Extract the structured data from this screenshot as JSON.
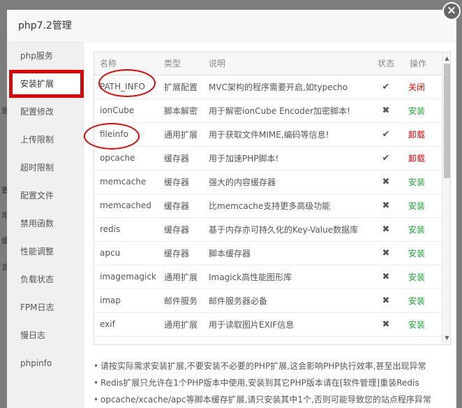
{
  "modal": {
    "title": "php7.2管理",
    "close_symbol": "×"
  },
  "sidebar": {
    "items": [
      {
        "label": "php服务",
        "active": false
      },
      {
        "label": "安装扩展",
        "active": true
      },
      {
        "label": "配置修改",
        "active": false
      },
      {
        "label": "上传限制",
        "active": false
      },
      {
        "label": "超时限制",
        "active": false
      },
      {
        "label": "配置文件",
        "active": false
      },
      {
        "label": "禁用函数",
        "active": false
      },
      {
        "label": "性能调整",
        "active": false
      },
      {
        "label": "负载状态",
        "active": false
      },
      {
        "label": "FPM日志",
        "active": false
      },
      {
        "label": "慢日志",
        "active": false
      },
      {
        "label": "phpinfo",
        "active": false
      }
    ]
  },
  "table": {
    "headers": {
      "name": "名称",
      "type": "类型",
      "desc": "说明",
      "status": "状态",
      "op": "操作"
    },
    "rows": [
      {
        "name": "PATH_INFO",
        "type": "扩展配置",
        "desc": "MVC架构的程序需要开启,如typecho",
        "status": "✔",
        "op": "关闭",
        "op_color": "red"
      },
      {
        "name": "ionCube",
        "type": "脚本解密",
        "desc": "用于解密ionCube Encoder加密脚本!",
        "status": "✖",
        "op": "安装",
        "op_color": "green"
      },
      {
        "name": "fileinfo",
        "type": "通用扩展",
        "desc": "用于获取文件MIME,编码等信息!",
        "status": "✔",
        "op": "卸载",
        "op_color": "red"
      },
      {
        "name": "opcache",
        "type": "缓存器",
        "desc": "用于加速PHP脚本!",
        "status": "✔",
        "op": "卸载",
        "op_color": "red"
      },
      {
        "name": "memcache",
        "type": "缓存器",
        "desc": "强大的内容缓存器",
        "status": "✖",
        "op": "安装",
        "op_color": "green"
      },
      {
        "name": "memcached",
        "type": "缓存器",
        "desc": "比memcache支持更多高级功能",
        "status": "✖",
        "op": "安装",
        "op_color": "green"
      },
      {
        "name": "redis",
        "type": "缓存器",
        "desc": "基于内存亦可持久化的Key-Value数据库",
        "status": "✖",
        "op": "安装",
        "op_color": "green"
      },
      {
        "name": "apcu",
        "type": "缓存器",
        "desc": "脚本缓存器",
        "status": "✖",
        "op": "安装",
        "op_color": "green"
      },
      {
        "name": "imagemagick",
        "type": "通用扩展",
        "desc": "Imagick高性能图形库",
        "status": "✖",
        "op": "安装",
        "op_color": "green"
      },
      {
        "name": "imap",
        "type": "邮件服务",
        "desc": "邮件服务器必备",
        "status": "✖",
        "op": "安装",
        "op_color": "green"
      },
      {
        "name": "exif",
        "type": "通用扩展",
        "desc": "用于读取图片EXIF信息",
        "status": "✖",
        "op": "安装",
        "op_color": "green"
      }
    ]
  },
  "tips": [
    "请按实际需求安装扩展,不要安装不必要的PHP扩展,这会影响PHP执行效率,甚至出现异常",
    "Redis扩展只允许在1个PHP版本中使用,安装到其它PHP版本请在[软件管理]重装Redis",
    "opcache/xcache/apc等脚本缓存扩展,请只安装其中1个,否则可能导致您的站点程序异常"
  ],
  "colors": {
    "accent_green": "#20a53a",
    "accent_red": "#e60000"
  }
}
